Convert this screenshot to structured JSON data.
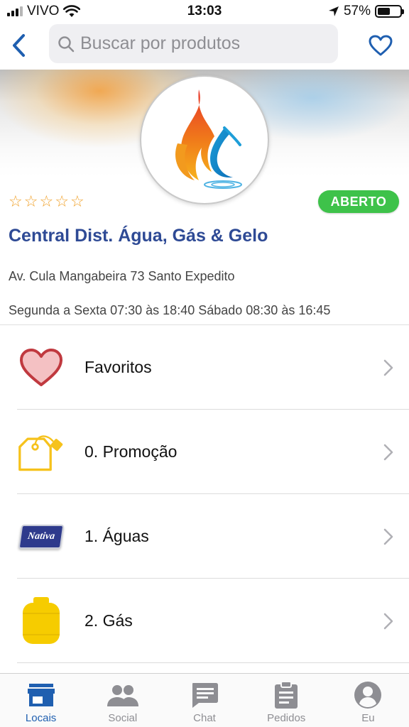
{
  "status_bar": {
    "carrier": "VIVO",
    "time": "13:03",
    "battery": "57%",
    "battery_level": 0.57
  },
  "navbar": {
    "search_placeholder": "Buscar por produtos",
    "back_icon": "chevron-left-icon",
    "favorite_icon": "heart-outline-icon"
  },
  "store": {
    "name": "Central Dist. Água, Gás & Gelo",
    "rating_stars": [
      "☆",
      "☆",
      "☆",
      "☆",
      "☆"
    ],
    "status": "ABERTO",
    "address": "Av. Cula Mangabeira 73 Santo Expedito",
    "hours": "Segunda a Sexta 07:30 às 18:40 Sábado 08:30 às 16:45"
  },
  "categories": [
    {
      "label": "Favoritos",
      "icon": "heart-icon"
    },
    {
      "label": "0. Promoção",
      "icon": "price-tag-icon"
    },
    {
      "label": "1. Águas",
      "icon": "nativa-logo",
      "logo_text": "Nativa"
    },
    {
      "label": "2. Gás",
      "icon": "gas-cylinder-icon"
    }
  ],
  "tabbar": {
    "tabs": [
      {
        "label": "Locais",
        "icon": "store-icon",
        "active": true
      },
      {
        "label": "Social",
        "icon": "people-icon",
        "active": false
      },
      {
        "label": "Chat",
        "icon": "chat-icon",
        "active": false
      },
      {
        "label": "Pedidos",
        "icon": "clipboard-icon",
        "active": false
      },
      {
        "label": "Eu",
        "icon": "account-icon",
        "active": false
      }
    ]
  },
  "colors": {
    "accent": "#2e4a95",
    "tab_active": "#1f5fb0",
    "open_badge": "#3ec24a",
    "star": "#f0a028"
  }
}
